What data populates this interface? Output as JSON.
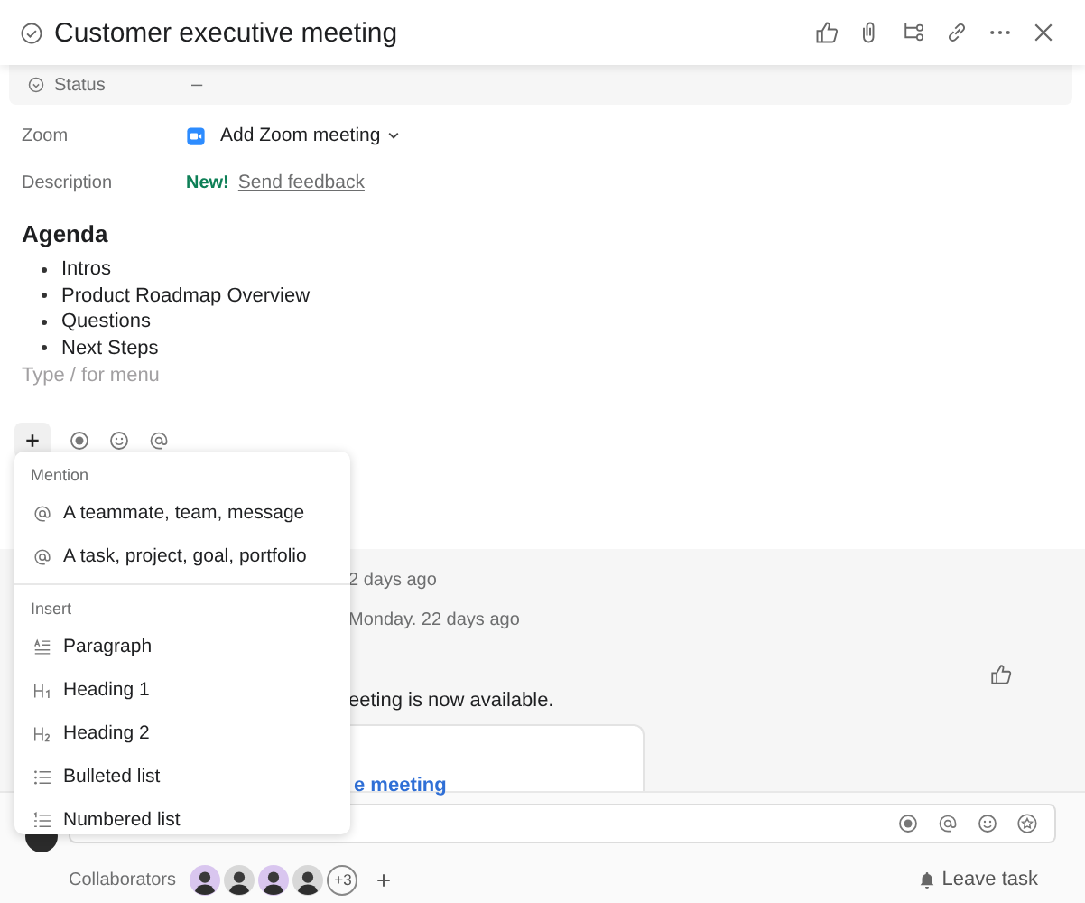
{
  "header": {
    "title": "Customer executive meeting",
    "completed": false
  },
  "status_field": {
    "label": "Status",
    "value": "–"
  },
  "zoom_field": {
    "label": "Zoom",
    "action": "Add Zoom meeting"
  },
  "description_field": {
    "label": "Description",
    "badge": "New!",
    "link": "Send feedback"
  },
  "description": {
    "heading": "Agenda",
    "bullets": [
      "Intros",
      "Product Roadmap Overview",
      "Questions",
      "Next Steps"
    ],
    "placeholder": "Type / for menu"
  },
  "menu": {
    "sections": [
      {
        "title": "Mention",
        "items": [
          {
            "label": "A teammate, team, message",
            "kind": "mention"
          },
          {
            "label": "A task, project, goal, portfolio",
            "kind": "mention"
          }
        ]
      },
      {
        "title": "Insert",
        "items": [
          {
            "label": "Paragraph",
            "kind": "paragraph"
          },
          {
            "label": "Heading 1",
            "kind": "heading1"
          },
          {
            "label": "Heading 2",
            "kind": "heading2"
          },
          {
            "label": "Bulleted list",
            "kind": "bulleted"
          },
          {
            "label": "Numbered list",
            "kind": "numbered"
          }
        ]
      }
    ]
  },
  "activity": {
    "time_1": "2 days ago",
    "time_2": "Monday.  22 days ago",
    "message": "eeting is now available.",
    "card_link": "e meeting"
  },
  "collaborators": {
    "label": "Collaborators",
    "more": "+3"
  },
  "leave": "Leave task"
}
